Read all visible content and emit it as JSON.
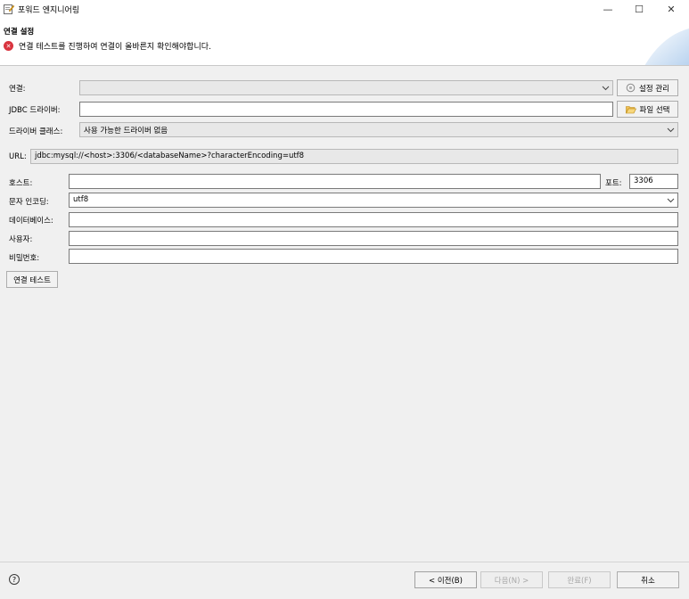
{
  "window": {
    "title": "포워드 엔지니어링",
    "minimize_glyph": "—",
    "maximize_glyph": "☐",
    "close_glyph": "✕"
  },
  "header": {
    "title": "연결 설정",
    "message": "연결 테스트를 진행하여 연결이 올바른지 확인해야합니다.",
    "error_glyph": "✕"
  },
  "form": {
    "connection": {
      "label": "연결:",
      "value": ""
    },
    "manage_button": "설정 관리",
    "jdbc_driver": {
      "label": "JDBC 드라이버:",
      "value": ""
    },
    "file_select_button": "파일 선택",
    "driver_class": {
      "label": "드라이버 클래스:",
      "value": "사용 가능한 드라이버 없음"
    },
    "url": {
      "label": "URL:",
      "value": "jdbc:mysql://<host>:3306/<databaseName>?characterEncoding=utf8"
    },
    "host": {
      "label": "호스트:",
      "value": ""
    },
    "port": {
      "label": "포트:",
      "value": "3306"
    },
    "encoding": {
      "label": "문자 인코딩:",
      "value": "utf8"
    },
    "database": {
      "label": "데이터베이스:",
      "value": ""
    },
    "user": {
      "label": "사용자:",
      "value": ""
    },
    "password": {
      "label": "비밀번호:",
      "value": ""
    },
    "test_button": "연결 테스트"
  },
  "footer": {
    "help_glyph": "?",
    "back_button": "< 이전(B)",
    "next_button": "다음(N) >",
    "finish_button": "완료(F)",
    "cancel_button": "취소"
  }
}
